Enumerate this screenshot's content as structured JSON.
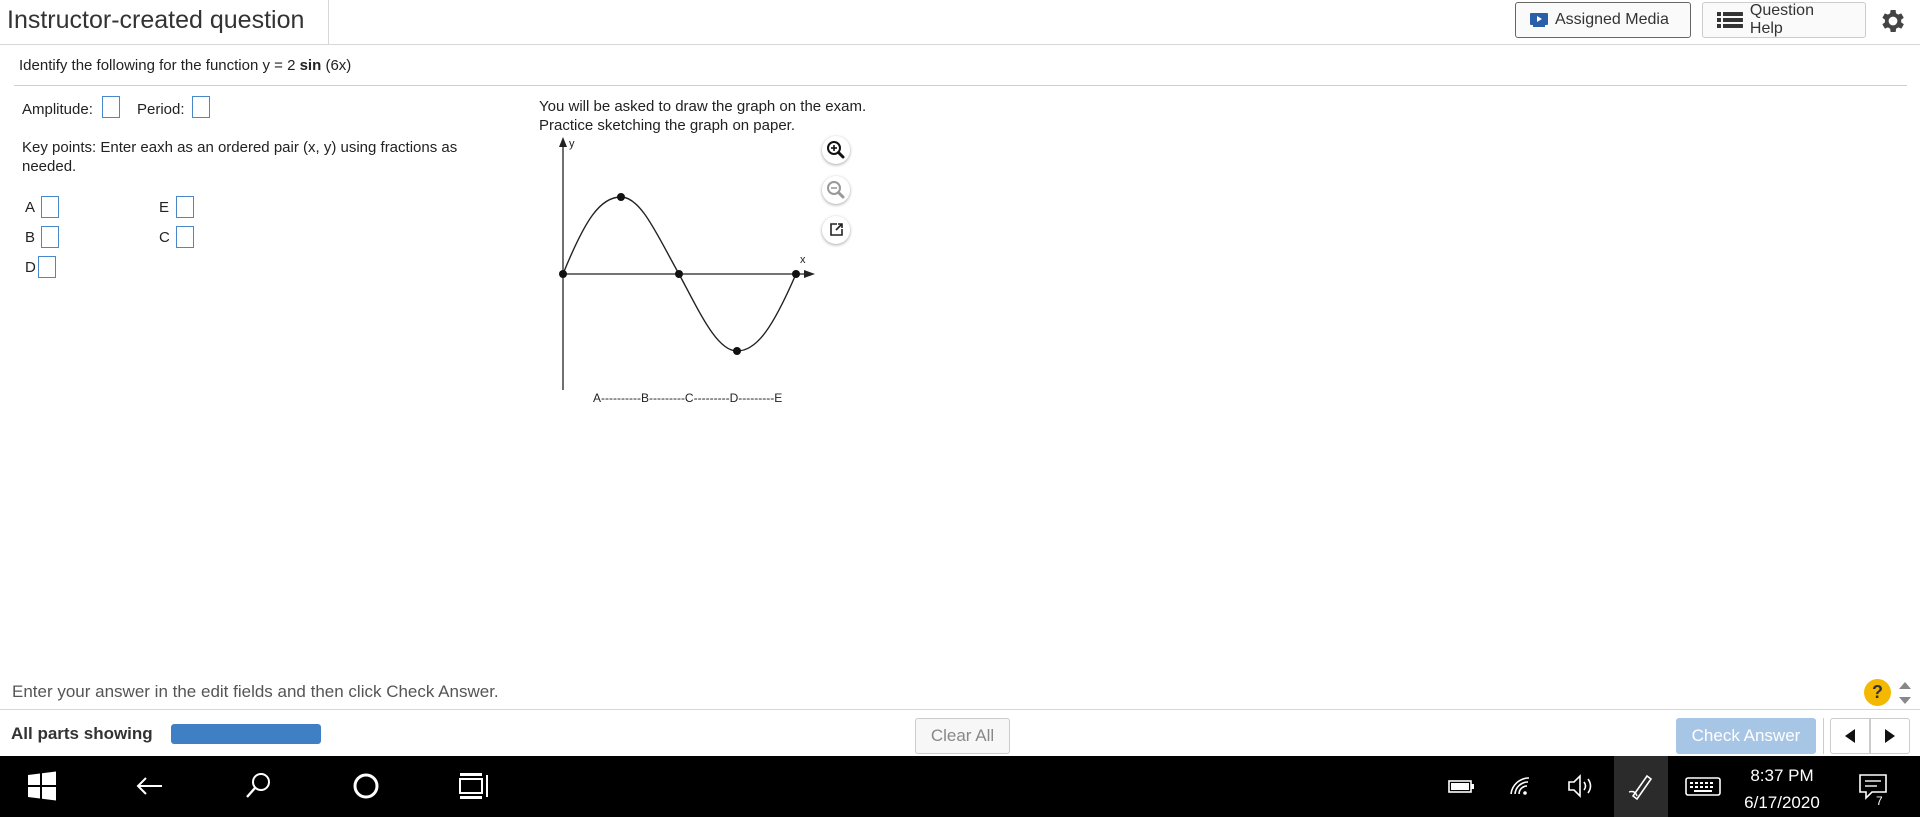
{
  "header": {
    "title": "Instructor-created question",
    "assigned_media_label": "Assigned Media",
    "question_help_label": "Question Help",
    "settings_icon": "gear-icon"
  },
  "question": {
    "prefix": "Identify the following for the function y = 2 ",
    "func_bold": "sin",
    "suffix": " (6x)",
    "amplitude_label": "Amplitude:",
    "period_label": "Period:",
    "keypoints_line1": "Key points: Enter eaxh as an ordered pair (x, y) using fractions as",
    "keypoints_line2": "needed.",
    "points": {
      "A": "A",
      "B": "B",
      "C": "C",
      "D": "D",
      "E": "E"
    }
  },
  "graph": {
    "note_line1": "You will be asked to draw the graph on the exam.",
    "note_line2": "Practice sketching the graph on paper.",
    "y_axis_label": "y",
    "x_axis_label": "x",
    "tick_caption": "A----------B---------C---------D---------E",
    "curve": "y = 2 sin(6x)",
    "zoom_in_icon": "zoom-in-icon",
    "zoom_out_icon": "zoom-out-icon",
    "popout_icon": "popout-icon"
  },
  "instructions": "Enter your answer in the edit fields and then click Check Answer.",
  "footer": {
    "all_parts": "All parts showing",
    "progress": 1.0,
    "clear_all": "Clear All",
    "check_answer": "Check Answer",
    "help_mark": "?"
  },
  "taskbar": {
    "time": "8:37 PM",
    "date": "6/17/2020",
    "notification_count": "7"
  },
  "colors": {
    "accent": "#3f7fc4",
    "check_answer_bg": "#a7c6e6",
    "help_badge": "#f5b800",
    "taskbar": "#000000"
  }
}
